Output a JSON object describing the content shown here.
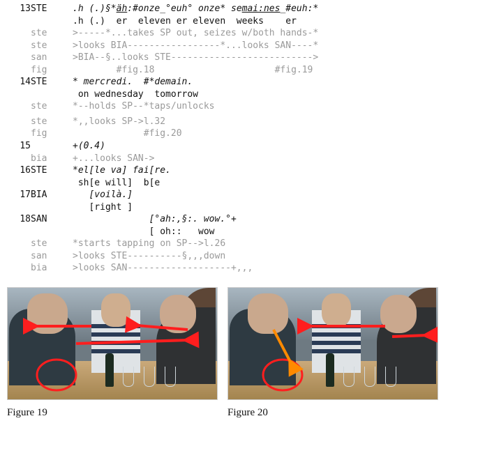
{
  "lines": {
    "l13a_num": "13",
    "l13a_sp": "STE",
    "l13a_body": ".h (.)§*äh:#onze_°euh° onze* semai:nes_#euh:*",
    "l13b_body": ".h (.)  er  eleven er eleven  weeks    er",
    "l13c_sp": "ste",
    "l13c_body": ">-----*...takes SP out, seizes w/both hands-*",
    "l13d_sp": "ste",
    "l13d_body": ">looks BIA-----------------*...looks SAN----*",
    "l13e_sp": "san",
    "l13e_body": ">BIA--§..looks STE-------------------------->",
    "l13f_sp": "fig",
    "l13f_body": "        #fig.18                      #fig.19",
    "l14a_num": "14",
    "l14a_sp": "STE",
    "l14a_body": "* mercredi.  #*demain.",
    "l14b_body": " on wednesday  tomorrow",
    "l14c_sp": "ste",
    "l14c_body": "*--holds SP--*taps/unlocks",
    "l14d_sp": "ste",
    "l14d_body": "*,,looks SP->l.32",
    "l14e_sp": "fig",
    "l14e_body": "             #fig.20",
    "l15a_num": "15",
    "l15a_body": "+(0.4)",
    "l15b_sp": "bia",
    "l15b_body": "+...looks SAN->",
    "l16a_num": "16",
    "l16a_sp": "STE",
    "l16a_body": "*el[le va] fai[re.",
    "l16b_body": " sh[e will]  b[e",
    "l17a_num": "17",
    "l17a_sp": "BIA",
    "l17a_body": "   [voilà.]",
    "l17b_body": "   [right ]",
    "l18a_num": "18",
    "l18a_sp": "SAN",
    "l18a_body": "              [°ah:,§:. wow.°+",
    "l18b_body": "              [ oh::   wow",
    "l18c_sp": "ste",
    "l18c_body": "*starts tapping on SP-->l.26",
    "l18d_sp": "san",
    "l18d_body": ">looks STE----------§,,,down",
    "l18e_sp": "bia",
    "l18e_body": ">looks SAN-------------------+,,,"
  },
  "figcap19": "Figure 19",
  "figcap20": "Figure 20"
}
